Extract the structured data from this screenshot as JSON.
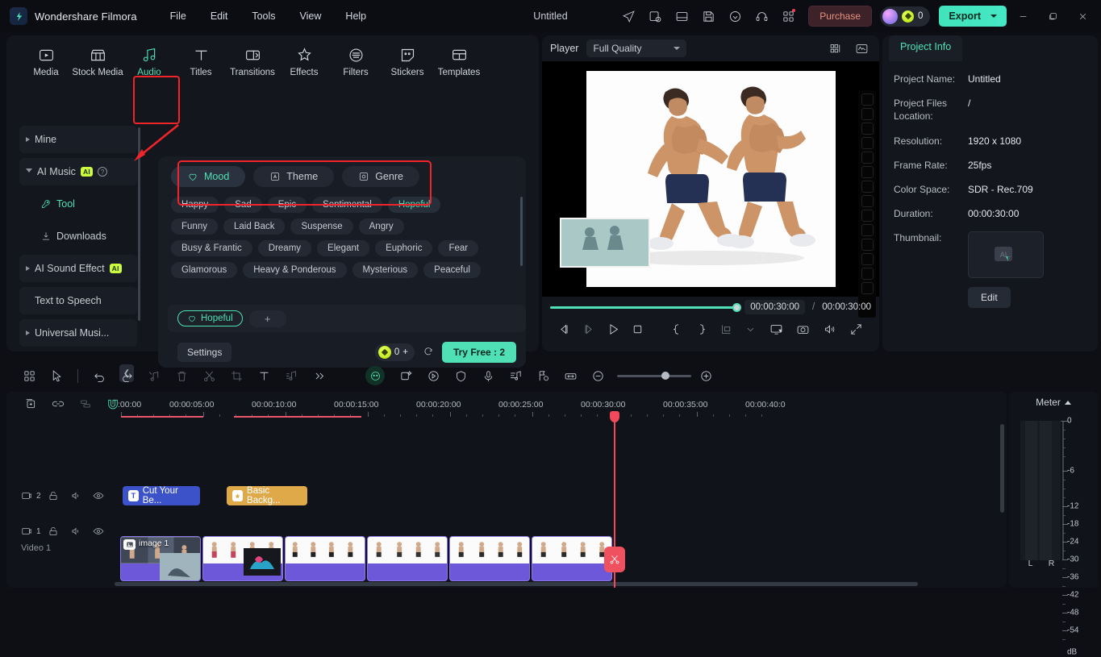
{
  "titlebar": {
    "brand": "Wondershare Filmora",
    "menus": [
      "File",
      "Edit",
      "Tools",
      "View",
      "Help"
    ],
    "doc_title": "Untitled",
    "icons": [
      "send-icon",
      "export-task-icon",
      "layout-icon",
      "save-icon",
      "cloud-icon",
      "support-icon",
      "apps-icon"
    ],
    "purchase_label": "Purchase",
    "coin_count": "0",
    "export_label": "Export",
    "window_buttons": [
      "minimize",
      "restore",
      "close"
    ]
  },
  "categories": [
    {
      "label": "Media",
      "icon": "media-icon",
      "active": false
    },
    {
      "label": "Stock Media",
      "icon": "stock-media-icon",
      "active": false
    },
    {
      "label": "Audio",
      "icon": "audio-icon",
      "active": true
    },
    {
      "label": "Titles",
      "icon": "titles-icon",
      "active": false
    },
    {
      "label": "Transitions",
      "icon": "transitions-icon",
      "active": false
    },
    {
      "label": "Effects",
      "icon": "effects-icon",
      "active": false
    },
    {
      "label": "Filters",
      "icon": "filters-icon",
      "active": false
    },
    {
      "label": "Stickers",
      "icon": "stickers-icon",
      "active": false
    },
    {
      "label": "Templates",
      "icon": "templates-icon",
      "active": false
    }
  ],
  "sidebar": {
    "items": [
      {
        "label": "Mine",
        "badge": "",
        "expanded": false,
        "indent": 0
      },
      {
        "label": "AI Music",
        "badge": "AI",
        "expanded": true,
        "indent": 0,
        "help": "?"
      },
      {
        "label": "Tool",
        "badge": "",
        "indent": 1,
        "icon": "tool-icon",
        "selected": true
      },
      {
        "label": "Downloads",
        "badge": "",
        "indent": 1,
        "icon": "download-icon"
      },
      {
        "label": "AI Sound Effect",
        "badge": "AI",
        "expanded": false,
        "indent": 0
      },
      {
        "label": "Text to Speech",
        "badge": "",
        "indent": 0
      },
      {
        "label": "Universal Musi...",
        "badge": "",
        "expanded": false,
        "indent": 0
      }
    ],
    "collapse_icon": "chevron-left-icon"
  },
  "ai_music": {
    "tabs": [
      {
        "label": "Mood",
        "icon": "mood-icon",
        "active": true
      },
      {
        "label": "Theme",
        "icon": "theme-icon",
        "active": false
      },
      {
        "label": "Genre",
        "icon": "genre-icon",
        "active": false
      }
    ],
    "tag_rows": [
      [
        "Happy",
        "Sad",
        "Epic",
        "Sentimental",
        "Hopeful"
      ],
      [
        "Funny",
        "Laid Back",
        "Suspense",
        "Angry"
      ],
      [
        "Busy & Frantic",
        "Dreamy",
        "Elegant",
        "Euphoric",
        "Fear"
      ],
      [
        "Glamorous",
        "Heavy & Ponderous",
        "Mysterious",
        "Peaceful"
      ]
    ],
    "selected_tag": "Hopeful",
    "add_label": "+",
    "settings_label": "Settings",
    "credits": "0",
    "credits_plus": "+",
    "try_free_label": "Try Free : 2"
  },
  "player": {
    "label": "Player",
    "quality": "Full Quality",
    "current_time": "00:00:30:00",
    "separator": "/",
    "total_time": "00:00:30:00",
    "controls": [
      "prev-frame-icon",
      "next-frame-icon",
      "play-icon",
      "stop-icon",
      "mark-in-icon",
      "mark-out-icon",
      "snapshot-group-icon",
      "chevron-down-icon",
      "pip-icon",
      "camera-icon",
      "volume-icon",
      "fullscreen-icon"
    ],
    "header_icons": [
      "grid-view-icon",
      "waveform-icon"
    ]
  },
  "project_info": {
    "tab_label": "Project Info",
    "rows": [
      {
        "key": "Project Name:",
        "value": "Untitled"
      },
      {
        "key": "Project Files Location:",
        "value": "/"
      },
      {
        "key": "Resolution:",
        "value": "1920 x 1080"
      },
      {
        "key": "Frame Rate:",
        "value": "25fps"
      },
      {
        "key": "Color Space:",
        "value": "SDR - Rec.709"
      },
      {
        "key": "Duration:",
        "value": "00:00:30:00"
      },
      {
        "key": "Thumbnail:",
        "value": ""
      }
    ],
    "edit_label": "Edit"
  },
  "timeline_toolbar": {
    "left_icons": [
      "grid-icon",
      "select-tool-icon",
      "undo-icon",
      "redo-icon",
      "audio-detach-icon",
      "delete-icon",
      "split-icon",
      "crop-icon",
      "text-icon",
      "audio-mix-icon",
      "more-icon"
    ],
    "right_icons": [
      "ai-face-icon",
      "smart-cutout-icon",
      "auto-reframe-icon",
      "shield-icon",
      "record-voice-icon",
      "beat-detect-icon",
      "marker-icon",
      "fit-icon"
    ],
    "zoom_out": "−",
    "zoom_in": "+"
  },
  "timeline": {
    "head_icons": [
      "add-track-icon",
      "link-icon",
      "group-icon",
      "magnet-icon"
    ],
    "ruler_labels": [
      ":00:00",
      "00:00:05:00",
      "00:00:10:00",
      "00:00:15:00",
      "00:00:20:00",
      "00:00:25:00",
      "00:00:30:00",
      "00:00:35:00",
      "00:00:40:0"
    ],
    "tracks": [
      {
        "num": "2",
        "type": "video",
        "label": ""
      },
      {
        "num": "1",
        "type": "video",
        "label": "Video 1"
      },
      {
        "num": "1",
        "type": "audio",
        "label": ""
      }
    ],
    "clips": [
      {
        "name": "Cut Your Be...",
        "type": "text"
      },
      {
        "name": "Basic Backg...",
        "type": "effect"
      },
      {
        "name": "image 1",
        "type": "video"
      }
    ]
  },
  "meter": {
    "title": "Meter",
    "scale": [
      "0",
      "-6",
      "-12",
      "-18",
      "-24",
      "-30",
      "-36",
      "-42",
      "-48",
      "-54",
      "dB"
    ],
    "channels": [
      "L",
      "R"
    ]
  },
  "colors": {
    "accent": "#4fe0b5",
    "highlight": "#f1242a",
    "text_clip": "#3c52c8",
    "effect_clip": "#dfa94a",
    "video_clip": "#6d58d9",
    "playhead": "#f04a5c"
  }
}
